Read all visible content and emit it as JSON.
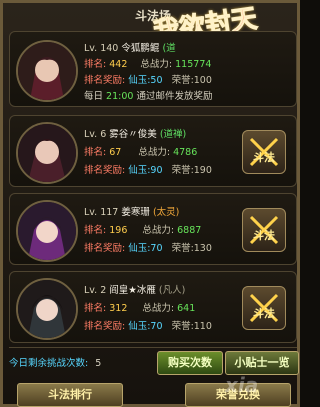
{
  "header": {
    "title": "斗法场",
    "brand": "我欲封天"
  },
  "self": {
    "level": "Lv. 140",
    "name": "令狐鹏鲲",
    "faction": "(道",
    "rank_label": "排名:",
    "rank_value": "442",
    "power_label": "总战力:",
    "power_value": "115774",
    "reward_label": "排名奖励:",
    "reward_jade": "仙玉:50",
    "reward_honor": "荣誉:100",
    "daily_prefix": "每日",
    "daily_time": "21:00",
    "daily_suffix": "通过邮件发放奖励"
  },
  "opponents": [
    {
      "level": "Lv. 6",
      "name": "雾谷〃俊美",
      "faction": "(道禅)",
      "rank_label": "排名:",
      "rank_value": "67",
      "power_label": "总战力:",
      "power_value": "4786",
      "reward_label": "排名奖励:",
      "reward_jade": "仙玉:90",
      "reward_honor": "荣誉:190",
      "challenge_label": "斗法"
    },
    {
      "level": "Lv. 117",
      "name": "姜寒珊",
      "faction": "(太灵)",
      "rank_label": "排名:",
      "rank_value": "196",
      "power_label": "总战力:",
      "power_value": "6887",
      "reward_label": "排名奖励:",
      "reward_jade": "仙玉:70",
      "reward_honor": "荣誉:130",
      "challenge_label": "斗法"
    },
    {
      "level": "Lv. 2",
      "name": "阎皇★冰雁",
      "faction": "(凡人)",
      "rank_label": "排名:",
      "rank_value": "312",
      "power_label": "总战力:",
      "power_value": "641",
      "reward_label": "排名奖励:",
      "reward_jade": "仙玉:70",
      "reward_honor": "荣誉:110",
      "challenge_label": "斗法"
    }
  ],
  "footer": {
    "remaining_label": "今日剩余挑战次数:",
    "remaining_value": "5",
    "buy_label": "购买次数",
    "help_label": "小贴士一览",
    "rank_button": "斗法排行",
    "shop_button": "荣誉兑换",
    "watermark": "xia"
  },
  "colors": {
    "border": "#6b5a3a",
    "rank_label": "#ff7d66",
    "value_yellow": "#ffcd4d",
    "value_green": "#67e35a",
    "jade_cyan": "#57d7ff"
  }
}
